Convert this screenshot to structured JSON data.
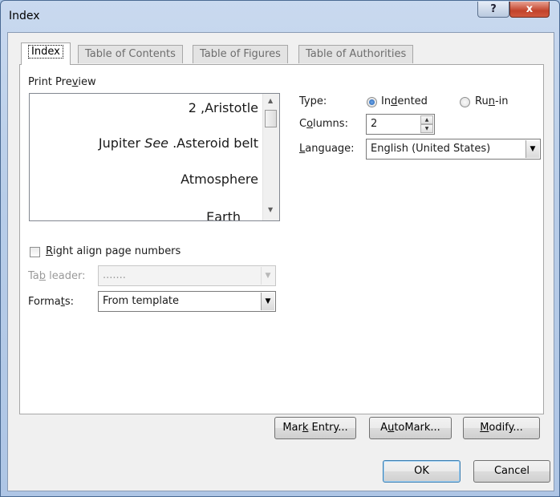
{
  "window": {
    "title": "Index",
    "help_label": "?",
    "close_label": "x"
  },
  "tabs": [
    {
      "label": "Index",
      "active": true
    },
    {
      "label": "Table of Contents"
    },
    {
      "label": "Table of Figures"
    },
    {
      "label": "Table of Authorities"
    }
  ],
  "print_preview": {
    "label": "Print Preview",
    "lines": [
      "2 ,Aristotle",
      "Asteroid belt",
      "Atmosphere",
      "Earth"
    ],
    "jupiter_text": "Jupiter",
    "see_text": "See",
    "asteroid_text": ".Asteroid belt"
  },
  "type": {
    "label": "Type:",
    "options": [
      "Indented",
      "Run-in"
    ],
    "selected": "Indented"
  },
  "columns": {
    "label": "Columns:",
    "value": "2"
  },
  "language": {
    "label": "Language:",
    "value": "English (United States)"
  },
  "right_align": {
    "label": "Right align page numbers",
    "checked": false
  },
  "tab_leader": {
    "label": "Tab leader:",
    "value": "......."
  },
  "formats": {
    "label": "Formats:",
    "value": "From template"
  },
  "buttons": {
    "mark_entry": "Mark Entry...",
    "automark": "AutoMark...",
    "modify": "Modify...",
    "ok": "OK",
    "cancel": "Cancel"
  },
  "colors": {
    "accent": "#3c7fb1",
    "title_bar": "#b8cde8",
    "close": "#c2432b"
  }
}
